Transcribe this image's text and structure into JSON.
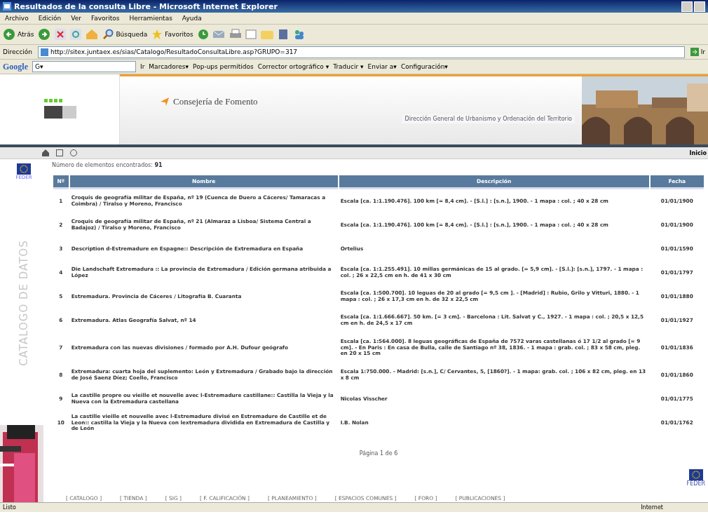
{
  "window": {
    "title": "Resultados de la consulta Libre - Microsoft Internet Explorer"
  },
  "menu": [
    "Archivo",
    "Edición",
    "Ver",
    "Favoritos",
    "Herramientas",
    "Ayuda"
  ],
  "toolbar": {
    "back": "Atrás",
    "search": "Búsqueda",
    "favorites": "Favoritos"
  },
  "address": {
    "label": "Dirección",
    "value": "http://sitex.juntaex.es/sias/Catalogo/ResultadoConsultaLibre.asp?GRUPO=317",
    "go": "Ir"
  },
  "google_bar": {
    "logo": "Google",
    "g": "G▾",
    "go": "Ir",
    "items": [
      "Marcadores▾",
      "Pop-ups permitidos",
      "Corrector ortográfico ▾",
      "Traducir ▾",
      "Enviar a▾",
      "Configuración▾"
    ]
  },
  "header": {
    "department": "Consejería de Fomento",
    "directorate": "Dirección General de Urbanismo y Ordenación del Territorio"
  },
  "nav": {
    "home_link": "Inicio"
  },
  "sidebar": {
    "logo_caption": "FEDER",
    "vertical_title": "CATALOGO DE DATOS"
  },
  "results": {
    "count_label": "Número de elementos encontrados:",
    "count": "91"
  },
  "table": {
    "columns": [
      "Nº",
      "Nombre",
      "Descripción",
      "Fecha"
    ],
    "rows": [
      {
        "n": "1",
        "name": "Croquis de geografía militar de España, nº 19 (Cuenca de Duero a Cáceres/ Tamaracas a Coimbra) / Tiralso y Moreno, Francisco",
        "desc": "Escala [ca. 1:1.190.476]. 100 km [= 8,4 cm]. - [S.l.] : [s.n.], 1900. - 1 mapa : col. ; 40 x 28 cm",
        "date": "01/01/1900"
      },
      {
        "n": "2",
        "name": "Croquis de geografía militar de España, nº 21 (Almaraz a Lisboa/ Sistema Central a Badajoz) / Tiralso y Moreno, Francisco",
        "desc": "Escala [ca. 1:1.190.476]. 100 km [= 8,4 cm]. - [S.l.] : [s.n.], 1900. - 1 mapa : col. ; 40 x 28 cm",
        "date": "01/01/1900"
      },
      {
        "n": "3",
        "name": "Description d-Estremadure en Espagne:: Descripción de Extremadura en España",
        "desc": "Ortelius",
        "date": "01/01/1590"
      },
      {
        "n": "4",
        "name": "Die Landschaft Extremadura :: La provincia de Extremadura / Edición germana atribuida a López",
        "desc": "Escala [ca. 1:1.255.491]. 10 millas germánicas de 15 al grado. [= 5,9 cm]. - [S.l.]: [s.n.], 1797. - 1 mapa : col. ; 26 x 22,5 cm en h. de 41 x 30 cm",
        "date": "01/01/1797"
      },
      {
        "n": "5",
        "name": "Estremadura. Provincia de Cáceres / Litografía B. Cuaranta",
        "desc": "Escala [ca. 1:500.700]. 10 leguas de 20 al grado [= 9,5 cm ]. - [Madrid] : Rubio, Grilo y Vitturi, 1880. - 1 mapa : col. ; 26 x 17,3 cm en h. de 32 x 22,5 cm",
        "date": "01/01/1880"
      },
      {
        "n": "6",
        "name": "Extremadura. Atlas Geografía Salvat, nº 14",
        "desc": "Escala [ca. 1:1.666.667]. 50 km. [= 3 cm]. - Barcelona : Lit. Salvat y C., 1927. - 1 mapa : col. ; 20,5 x 12,5 cm en h. de 24,5 x 17 cm",
        "date": "01/01/1927"
      },
      {
        "n": "7",
        "name": "Extremadura con las nuevas divisiones / formado por A.H. Dufour geógrafo",
        "desc": "Escala [ca. 1:564.000]. 8 leguas geográficas de España de 7572 varas castellanas ó 17 1/2 al grado [= 9 cm]. - En Paris : En casa de Bulla, calle de Santiago nº 38, 1836. - 1 mapa : grab. col. ; 83 x 58 cm, pleg. en 20 x 15 cm",
        "date": "01/01/1836"
      },
      {
        "n": "8",
        "name": "Extremadura: cuarta hoja del suplemento: León y Extremadura / Grabado bajo la dirección de José Saenz Díez; Coello, Francisco",
        "desc": "Escala 1:750.000. - Madrid: [s.n.], C/ Cervantes, 5, [1860?]. - 1 mapa: grab. col. ; 106 x 82 cm, pleg. en 13 x 8 cm",
        "date": "01/01/1860"
      },
      {
        "n": "9",
        "name": "La castille propre ou vieille et nouvelle avec l-Estremadure castillane:: Castilla la Vieja y la Nueva con la Extremadura castellana",
        "desc": "Nicolas Visscher",
        "date": "01/01/1775"
      },
      {
        "n": "10",
        "name": "La castille vieille et nouvelle avec l-Estremadure divisé en Estremadure de Castille et de Leon:: castilla la Vieja y la Nueva con lextremadura dividida en Extremadura de Castilla y de León",
        "desc": "I.B. Nolan",
        "date": "01/01/1762"
      }
    ]
  },
  "pagination": "Página 1 de 6",
  "footer_links": [
    "[ CATALOGO ]",
    "[ TIENDA ]",
    "[ SIG ]",
    "[ F. CALIFICACIÓN ]",
    "[ PLANEAMIENTO ]",
    "[ ESPACIOS COMUNES ]",
    "[ FORO ]",
    "[ PUBLICACIONES ]"
  ],
  "feder_caption": "FEDER",
  "status_bar": {
    "text": "Listo",
    "zone": "Internet"
  }
}
